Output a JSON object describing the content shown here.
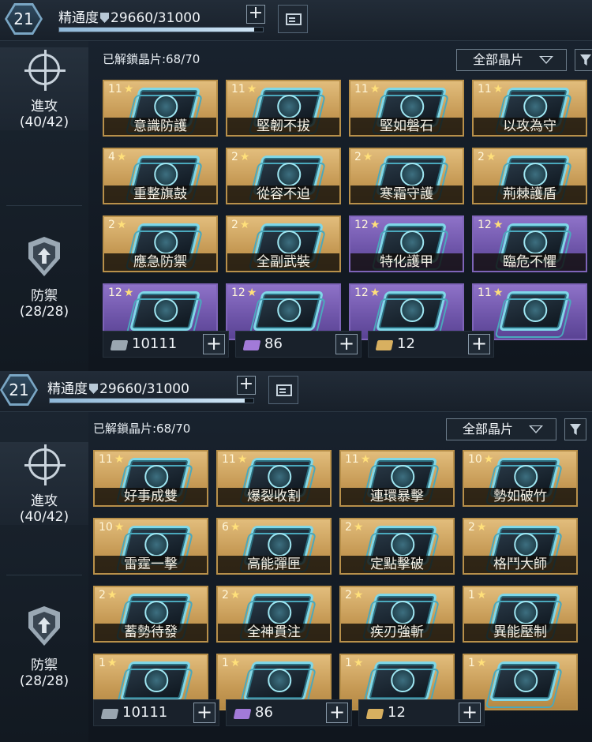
{
  "panels": [
    {
      "topbar": {
        "level": "21",
        "proficiency_label": "精通度",
        "proficiency_value": "29660/31000",
        "progress": 0.957
      },
      "unlocked_text": "已解鎖晶片:68/70",
      "filter_label": "全部晶片",
      "sidebar": [
        {
          "label": "進攻",
          "count": "(40/42)",
          "icon": "crosshair-icon"
        },
        {
          "label": "防禦",
          "count": "(28/28)",
          "icon": "shield-arrow-icon"
        }
      ],
      "cards": [
        {
          "stars": "11",
          "name": "意識防護",
          "rarity": "gold"
        },
        {
          "stars": "11",
          "name": "堅韌不拔",
          "rarity": "gold"
        },
        {
          "stars": "11",
          "name": "堅如磐石",
          "rarity": "gold"
        },
        {
          "stars": "11",
          "name": "以攻為守",
          "rarity": "gold"
        },
        {
          "stars": "4",
          "name": "重整旗鼓",
          "rarity": "gold"
        },
        {
          "stars": "2",
          "name": "從容不迫",
          "rarity": "gold"
        },
        {
          "stars": "2",
          "name": "寒霜守護",
          "rarity": "gold"
        },
        {
          "stars": "2",
          "name": "荊棘護盾",
          "rarity": "gold"
        },
        {
          "stars": "2",
          "name": "應急防禦",
          "rarity": "gold"
        },
        {
          "stars": "2",
          "name": "全副武裝",
          "rarity": "gold"
        },
        {
          "stars": "12",
          "name": "特化護甲",
          "rarity": "purple"
        },
        {
          "stars": "12",
          "name": "臨危不懼",
          "rarity": "purple"
        },
        {
          "stars": "12",
          "name": "",
          "rarity": "purple"
        },
        {
          "stars": "12",
          "name": "",
          "rarity": "purple"
        },
        {
          "stars": "12",
          "name": "",
          "rarity": "purple"
        },
        {
          "stars": "11",
          "name": "",
          "rarity": "purple"
        }
      ],
      "resources": [
        {
          "amount": "10111",
          "color": "#9aa6b0"
        },
        {
          "amount": "86",
          "color": "#a27ad8"
        },
        {
          "amount": "12",
          "color": "#d8b060"
        }
      ]
    },
    {
      "topbar": {
        "level": "21",
        "proficiency_label": "精通度",
        "proficiency_value": "29660/31000",
        "progress": 0.957
      },
      "unlocked_text": "已解鎖晶片:68/70",
      "filter_label": "全部晶片",
      "sidebar": [
        {
          "label": "進攻",
          "count": "(40/42)",
          "icon": "crosshair-icon"
        },
        {
          "label": "防禦",
          "count": "(28/28)",
          "icon": "shield-arrow-icon"
        }
      ],
      "cards": [
        {
          "stars": "11",
          "name": "好事成雙",
          "rarity": "gold"
        },
        {
          "stars": "11",
          "name": "爆裂收割",
          "rarity": "gold"
        },
        {
          "stars": "11",
          "name": "連環暴擊",
          "rarity": "gold"
        },
        {
          "stars": "10",
          "name": "勢如破竹",
          "rarity": "gold"
        },
        {
          "stars": "10",
          "name": "雷霆一擊",
          "rarity": "gold"
        },
        {
          "stars": "6",
          "name": "高能彈匣",
          "rarity": "gold"
        },
        {
          "stars": "2",
          "name": "定點擊破",
          "rarity": "gold"
        },
        {
          "stars": "2",
          "name": "格鬥大師",
          "rarity": "gold"
        },
        {
          "stars": "2",
          "name": "蓄勢待發",
          "rarity": "gold"
        },
        {
          "stars": "2",
          "name": "全神貫注",
          "rarity": "gold"
        },
        {
          "stars": "2",
          "name": "疾刃強斬",
          "rarity": "gold"
        },
        {
          "stars": "1",
          "name": "異能壓制",
          "rarity": "gold"
        },
        {
          "stars": "1",
          "name": "",
          "rarity": "gold"
        },
        {
          "stars": "1",
          "name": "",
          "rarity": "gold"
        },
        {
          "stars": "1",
          "name": "",
          "rarity": "gold"
        },
        {
          "stars": "1",
          "name": "",
          "rarity": "gold"
        }
      ],
      "resources": [
        {
          "amount": "10111",
          "color": "#9aa6b0"
        },
        {
          "amount": "86",
          "color": "#a27ad8"
        },
        {
          "amount": "12",
          "color": "#d8b060"
        }
      ]
    }
  ]
}
